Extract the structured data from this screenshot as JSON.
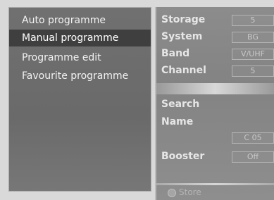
{
  "menu": {
    "items": [
      {
        "label": "Auto programme",
        "selected": false
      },
      {
        "label": "Manual programme",
        "selected": true
      },
      {
        "label": "Programme edit",
        "selected": false
      },
      {
        "label": "Favourite programme",
        "selected": false
      }
    ]
  },
  "settings": {
    "storage": {
      "label": "Storage",
      "value": "5"
    },
    "system": {
      "label": "System",
      "value": "BG"
    },
    "band": {
      "label": "Band",
      "value": "V/UHF"
    },
    "channel": {
      "label": "Channel",
      "value": "5"
    },
    "search": {
      "label": "Search"
    },
    "name": {
      "label": "Name",
      "value": "C 05"
    },
    "booster": {
      "label": "Booster",
      "value": "Off"
    }
  },
  "footer": {
    "store_label": "Store"
  },
  "colors": {
    "panel_left": "#6e6e6e",
    "panel_right": "#8a8a8a",
    "selected_row": "#3f3f3f"
  }
}
